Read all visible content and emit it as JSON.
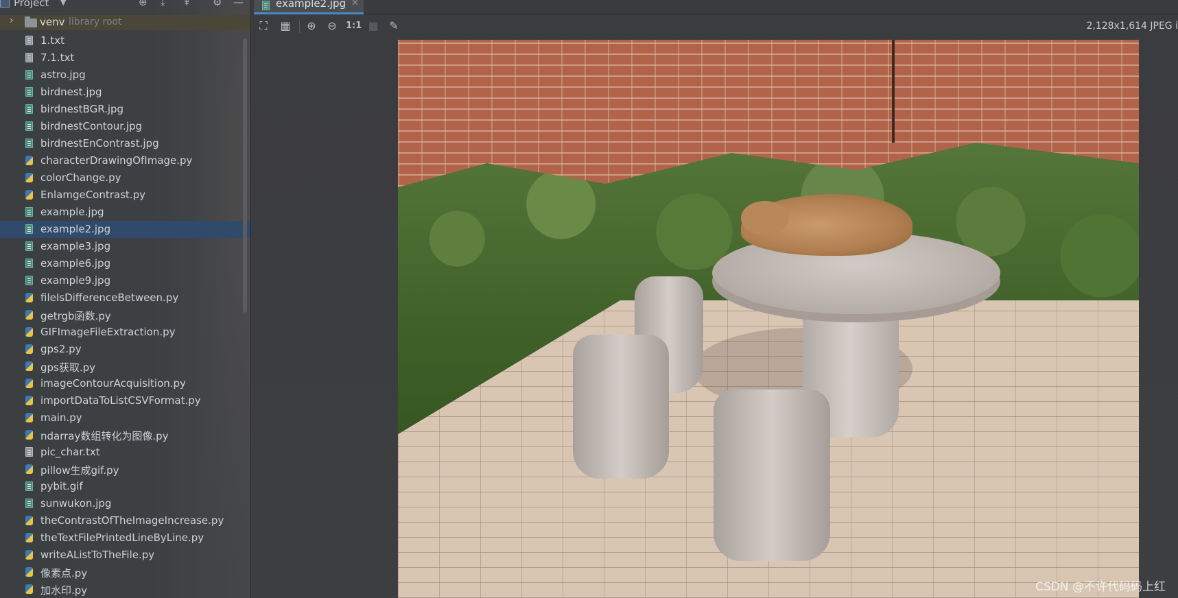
{
  "project_panel": {
    "title": "Project",
    "venv": {
      "name": "venv",
      "annotation": "library root"
    },
    "files": [
      {
        "name": "1.txt",
        "type": "txt"
      },
      {
        "name": "7.1.txt",
        "type": "txt"
      },
      {
        "name": "astro.jpg",
        "type": "img"
      },
      {
        "name": "birdnest.jpg",
        "type": "img"
      },
      {
        "name": "birdnestBGR.jpg",
        "type": "img"
      },
      {
        "name": "birdnestContour.jpg",
        "type": "img"
      },
      {
        "name": "birdnestEnContrast.jpg",
        "type": "img"
      },
      {
        "name": "characterDrawingOfImage.py",
        "type": "py"
      },
      {
        "name": "colorChange.py",
        "type": "py"
      },
      {
        "name": "EnlamgeContrast.py",
        "type": "py"
      },
      {
        "name": "example.jpg",
        "type": "img"
      },
      {
        "name": "example2.jpg",
        "type": "img",
        "selected": true
      },
      {
        "name": "example3.jpg",
        "type": "img"
      },
      {
        "name": "example6.jpg",
        "type": "img"
      },
      {
        "name": "example9.jpg",
        "type": "img"
      },
      {
        "name": "fileIsDifferenceBetween.py",
        "type": "py"
      },
      {
        "name": "getrgb函数.py",
        "type": "py"
      },
      {
        "name": "GIFImageFileExtraction.py",
        "type": "py"
      },
      {
        "name": "gps2.py",
        "type": "py"
      },
      {
        "name": "gps获取.py",
        "type": "py"
      },
      {
        "name": "imageContourAcquisition.py",
        "type": "py"
      },
      {
        "name": "importDataToListCSVFormat.py",
        "type": "py"
      },
      {
        "name": "main.py",
        "type": "py"
      },
      {
        "name": "ndarray数组转化为图像.py",
        "type": "py"
      },
      {
        "name": "pic_char.txt",
        "type": "txt"
      },
      {
        "name": "pillow生成gif.py",
        "type": "py"
      },
      {
        "name": "pybit.gif",
        "type": "img"
      },
      {
        "name": "sunwukon.jpg",
        "type": "img"
      },
      {
        "name": "theContrastOfTheImageIncrease.py",
        "type": "py"
      },
      {
        "name": "theTextFilePrintedLineByLine.py",
        "type": "py"
      },
      {
        "name": "writeAListToTheFile.py",
        "type": "py"
      },
      {
        "name": "像素点.py",
        "type": "py"
      },
      {
        "name": "加水印.py",
        "type": "py"
      }
    ]
  },
  "editor": {
    "active_tab": "example2.jpg",
    "image_info": "2,128x1,614 JPEG i",
    "toolbar_icons": [
      "fit-to-window-icon",
      "grid-icon",
      "zoom-in-icon",
      "zoom-out-icon",
      "actual-size-icon",
      "background-icon",
      "color-picker-icon"
    ],
    "actual_size_label": "1:1"
  },
  "watermark": "CSDN @不许代码码上红"
}
